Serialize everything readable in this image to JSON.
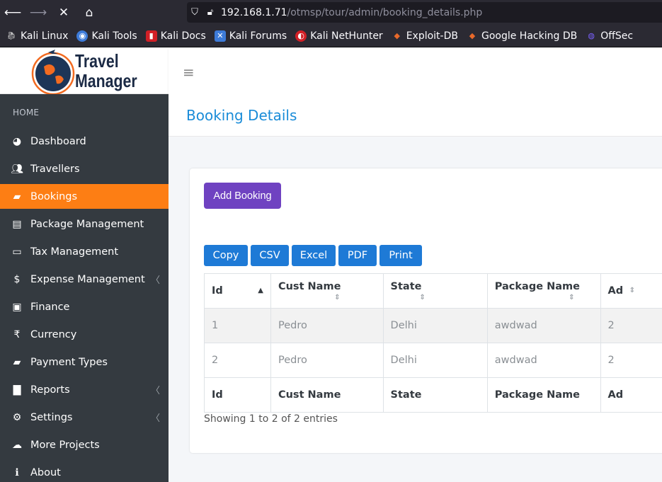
{
  "browser": {
    "url_host": "192.168.1.71",
    "url_path": "/otmsp/tour/admin/booking_details.php",
    "bookmarks": [
      {
        "label": "Kali Linux",
        "icon": "kali-icon",
        "color": "#d9d9d9"
      },
      {
        "label": "Kali Tools",
        "icon": "kali-tools-icon",
        "color": "#3d7bd9"
      },
      {
        "label": "Kali Docs",
        "icon": "kali-docs-icon",
        "color": "#d11f26"
      },
      {
        "label": "Kali Forums",
        "icon": "kali-forums-icon",
        "color": "#3d7bd9"
      },
      {
        "label": "Kali NetHunter",
        "icon": "nethunter-icon",
        "color": "#d11f26"
      },
      {
        "label": "Exploit-DB",
        "icon": "exploit-db-icon",
        "color": "#e8692a"
      },
      {
        "label": "Google Hacking DB",
        "icon": "ghdb-icon",
        "color": "#e8692a"
      },
      {
        "label": "OffSec",
        "icon": "offsec-icon",
        "color": "#7b61ff"
      }
    ]
  },
  "logo": {
    "line1": "Travel",
    "line2": "Manager"
  },
  "sidebar": {
    "heading": "HOME",
    "items": [
      {
        "label": "Dashboard",
        "icon": "dashboard-icon",
        "glyph": "◕"
      },
      {
        "label": "Travellers",
        "icon": "users-icon",
        "glyph": "👥"
      },
      {
        "label": "Bookings",
        "icon": "book-icon",
        "glyph": "▰",
        "active": true
      },
      {
        "label": "Package Management",
        "icon": "briefcase-icon",
        "glyph": "▤"
      },
      {
        "label": "Tax Management",
        "icon": "credit-card-icon",
        "glyph": "▭"
      },
      {
        "label": "Expense Management",
        "icon": "dollar-icon",
        "glyph": "$",
        "chevron": true
      },
      {
        "label": "Finance",
        "icon": "money-bill-icon",
        "glyph": "▣"
      },
      {
        "label": "Currency",
        "icon": "rupee-icon",
        "glyph": "₹"
      },
      {
        "label": "Payment Types",
        "icon": "book-icon",
        "glyph": "▰"
      },
      {
        "label": "Reports",
        "icon": "report-icon",
        "glyph": "▇",
        "chevron": true
      },
      {
        "label": "Settings",
        "icon": "gear-icon",
        "glyph": "⚙",
        "chevron": true
      },
      {
        "label": "More Projects",
        "icon": "cloud-download-icon",
        "glyph": "☁"
      },
      {
        "label": "About",
        "icon": "info-icon",
        "glyph": "ℹ"
      }
    ]
  },
  "page": {
    "title": "Booking Details"
  },
  "card": {
    "add_button": "Add Booking",
    "export_buttons": [
      "Copy",
      "CSV",
      "Excel",
      "PDF",
      "Print"
    ],
    "columns": [
      "Id",
      "Cust Name",
      "State",
      "Package Name",
      "Ad"
    ],
    "rows": [
      [
        "1",
        "Pedro",
        "Delhi",
        "awdwad",
        "2"
      ],
      [
        "2",
        "Pedro",
        "Delhi",
        "awdwad",
        "2"
      ]
    ],
    "info": "Showing 1 to 2 of 2 entries"
  },
  "colors": {
    "sidebar": "#343a40",
    "active": "#fd7e14",
    "primary": "#1e7ad6",
    "purple": "#6f42c1",
    "title": "#1a8cd8"
  }
}
